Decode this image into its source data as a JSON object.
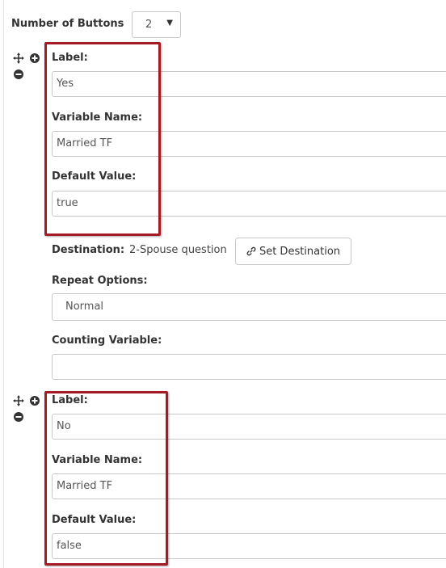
{
  "settings": {
    "number_of_buttons_label": "Number of Buttons",
    "number_of_buttons_value": "2"
  },
  "buttons": [
    {
      "label_label": "Label:",
      "label_value": "Yes",
      "variable_name_label": "Variable Name:",
      "variable_name_value": "Married TF",
      "default_value_label": "Default Value:",
      "default_value_value": "true",
      "destination_label": "Destination:",
      "destination_value": "2-Spouse question",
      "set_destination_label": "Set Destination",
      "repeat_options_label": "Repeat Options:",
      "repeat_options_value": "Normal",
      "counting_variable_label": "Counting Variable:",
      "counting_variable_value": ""
    },
    {
      "label_label": "Label:",
      "label_value": "No",
      "variable_name_label": "Variable Name:",
      "variable_name_value": "Married TF",
      "default_value_label": "Default Value:",
      "default_value_value": "false"
    }
  ],
  "icons": [
    "move-icon",
    "add-circle-icon",
    "remove-circle-icon",
    "link-icon",
    "caret-down-icon"
  ],
  "colors": {
    "highlight_border": "#a31c24",
    "field_border": "#c8c8c8",
    "text": "#333333"
  }
}
